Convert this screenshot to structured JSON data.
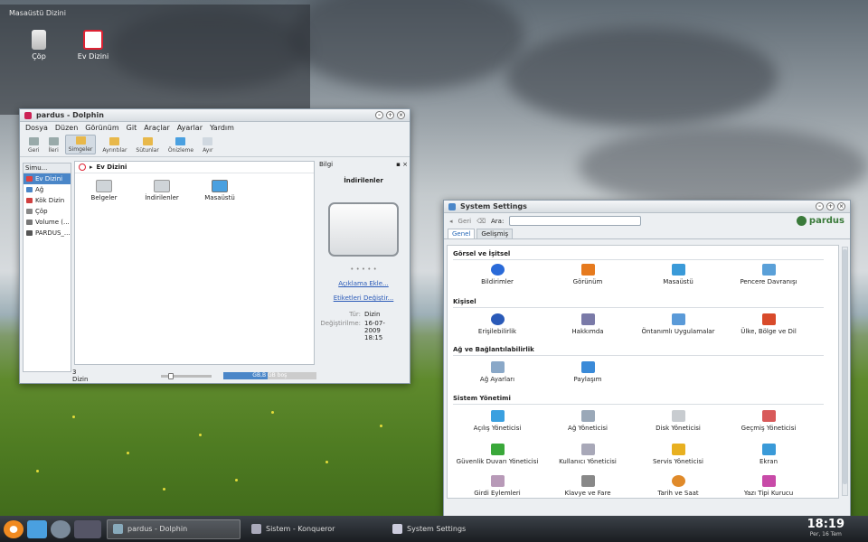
{
  "desktop": {
    "folder_title": "Masaüstü Dizini",
    "icons": [
      {
        "label": "Çöp",
        "icon": "trash-icon"
      },
      {
        "label": "Ev Dizini",
        "icon": "home-icon"
      }
    ]
  },
  "dolphin": {
    "title": "pardus - Dolphin",
    "menu": [
      "Dosya",
      "Düzen",
      "Görünüm",
      "Git",
      "Araçlar",
      "Ayarlar",
      "Yardım"
    ],
    "toolbar": [
      {
        "label": "Geri",
        "icon": "back-arrow-icon"
      },
      {
        "label": "İleri",
        "icon": "forward-arrow-icon"
      },
      {
        "label": "Simgeler",
        "icon": "icons-view-icon",
        "active": true
      },
      {
        "label": "Ayrıntılar",
        "icon": "details-view-icon"
      },
      {
        "label": "Sütunlar",
        "icon": "columns-view-icon"
      },
      {
        "label": "Önizleme",
        "icon": "preview-icon"
      },
      {
        "label": "Ayır",
        "icon": "split-icon"
      }
    ],
    "places_header": "Simu...",
    "places": [
      {
        "label": "Ev Dizini",
        "selected": true,
        "color": "#e04040"
      },
      {
        "label": "Ağ",
        "color": "#4a86c8"
      },
      {
        "label": "Kök Dizin",
        "color": "#d04040"
      },
      {
        "label": "Çöp",
        "color": "#888888"
      },
      {
        "label": "Volume (...",
        "color": "#777777"
      },
      {
        "label": "PARDUS_...",
        "color": "#555555"
      }
    ],
    "breadcrumb": "Ev Dizini",
    "files": [
      {
        "label": "Belgeler",
        "color": "#cfd4d8"
      },
      {
        "label": "İndirilenler",
        "color": "#cfd4d8"
      },
      {
        "label": "Masaüstü",
        "color": "#4aa0e0"
      }
    ],
    "info_panel": {
      "header": "Bilgi",
      "name": "İndirilenler",
      "rating": "• • • • •",
      "add_comment_link": "Açıklama Ekle...",
      "edit_tags_link": "Etiketleri Değiştir...",
      "type_label": "Tür:",
      "type_value": "Dizin",
      "modified_label": "Değiştirilme:",
      "modified_value": "16-07-2009 18:15"
    },
    "status": {
      "count": "3 Dizin",
      "disk_used": "GB,B",
      "disk_free": "GB boş",
      "disk_fraction": 0.48
    }
  },
  "system_settings": {
    "title": "System Settings",
    "back_label": "Geri",
    "search_label": "Ara:",
    "search_value": "",
    "logo_text": "pardus",
    "tabs": [
      {
        "label": "Genel",
        "active": true
      },
      {
        "label": "Gelişmiş"
      }
    ],
    "sections": [
      {
        "title": "Görsel ve İşitsel",
        "items": [
          {
            "label": "Bildirimler",
            "color": "#2a6ad8"
          },
          {
            "label": "Görünüm",
            "color": "#e67a1e"
          },
          {
            "label": "Masaüstü",
            "color": "#3a9ad8"
          },
          {
            "label": "Pencere Davranışı",
            "color": "#5aa0d8"
          }
        ]
      },
      {
        "title": "Kişisel",
        "items": [
          {
            "label": "Erişilebilirlik",
            "color": "#2a5ab8"
          },
          {
            "label": "Hakkımda",
            "color": "#7a7aa8"
          },
          {
            "label": "Öntanımlı Uygulamalar",
            "color": "#5a9ad8"
          },
          {
            "label": "Ülke, Bölge ve Dil",
            "color": "#d84a2a"
          }
        ]
      },
      {
        "title": "Ağ ve Bağlantılabilirlik",
        "items": [
          {
            "label": "Ağ Ayarları",
            "color": "#8aa8c8"
          },
          {
            "label": "Paylaşım",
            "color": "#3a8ad8"
          }
        ]
      },
      {
        "title": "Sistem Yönetimi",
        "items": [
          {
            "label": "Açılış Yöneticisi",
            "color": "#3aa0e0"
          },
          {
            "label": "Ağ Yöneticisi",
            "color": "#9aa8b8"
          },
          {
            "label": "Disk Yöneticisi",
            "color": "#c8ccd0"
          },
          {
            "label": "Geçmiş Yöneticisi",
            "color": "#d85a5a"
          },
          {
            "label": "Güvenlik Duvarı Yöneticisi",
            "color": "#3aa83a"
          },
          {
            "label": "Kullanıcı Yöneticisi",
            "color": "#a8a8b8"
          },
          {
            "label": "Servis Yöneticisi",
            "color": "#e8b020"
          },
          {
            "label": "Ekran",
            "color": "#3a9ad8"
          },
          {
            "label": "Girdi Eylemleri",
            "color": "#b89ab8"
          },
          {
            "label": "Klavye ve Fare",
            "color": "#888888"
          },
          {
            "label": "Tarih ve Saat",
            "color": "#e08a2a"
          },
          {
            "label": "Yazı Tipi Kurucu",
            "color": "#c84aa8"
          }
        ]
      }
    ]
  },
  "taskbar": {
    "tasks": [
      {
        "label": "pardus - Dolphin",
        "active": true
      },
      {
        "label": "Sistem - Konqueror"
      },
      {
        "label": "System Settings"
      }
    ],
    "time": "18:19",
    "date": "Per, 16 Tem"
  }
}
